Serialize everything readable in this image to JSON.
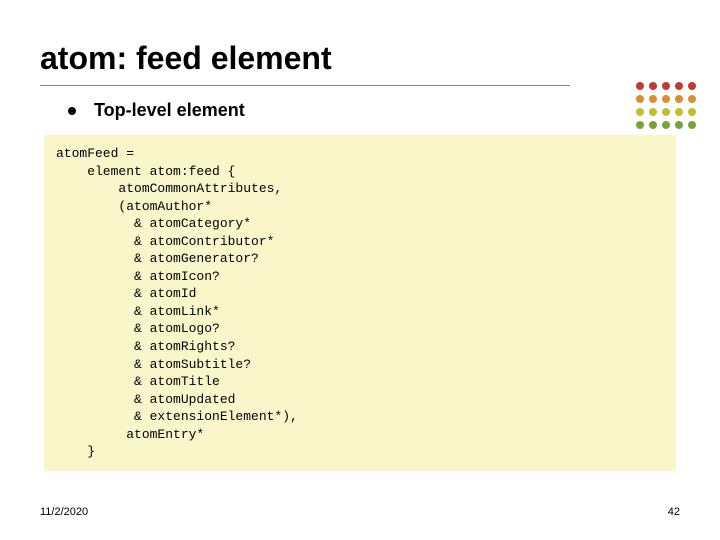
{
  "title": "atom: feed element",
  "bullet": "Top-level element",
  "code": "atomFeed =\n    element atom:feed {\n        atomCommonAttributes,\n        (atomAuthor*\n          & atomCategory*\n          & atomContributor*\n          & atomGenerator?\n          & atomIcon?\n          & atomId\n          & atomLink*\n          & atomLogo?\n          & atomRights?\n          & atomSubtitle?\n          & atomTitle\n          & atomUpdated\n          & extensionElement*),\n         atomEntry*\n    }",
  "footer": {
    "date": "11/2/2020",
    "page": "42"
  },
  "decor_colors": {
    "row1": "#be3a33",
    "row2": "#d98f2e",
    "row3": "#bfbf30",
    "row4": "#7aa23b"
  }
}
